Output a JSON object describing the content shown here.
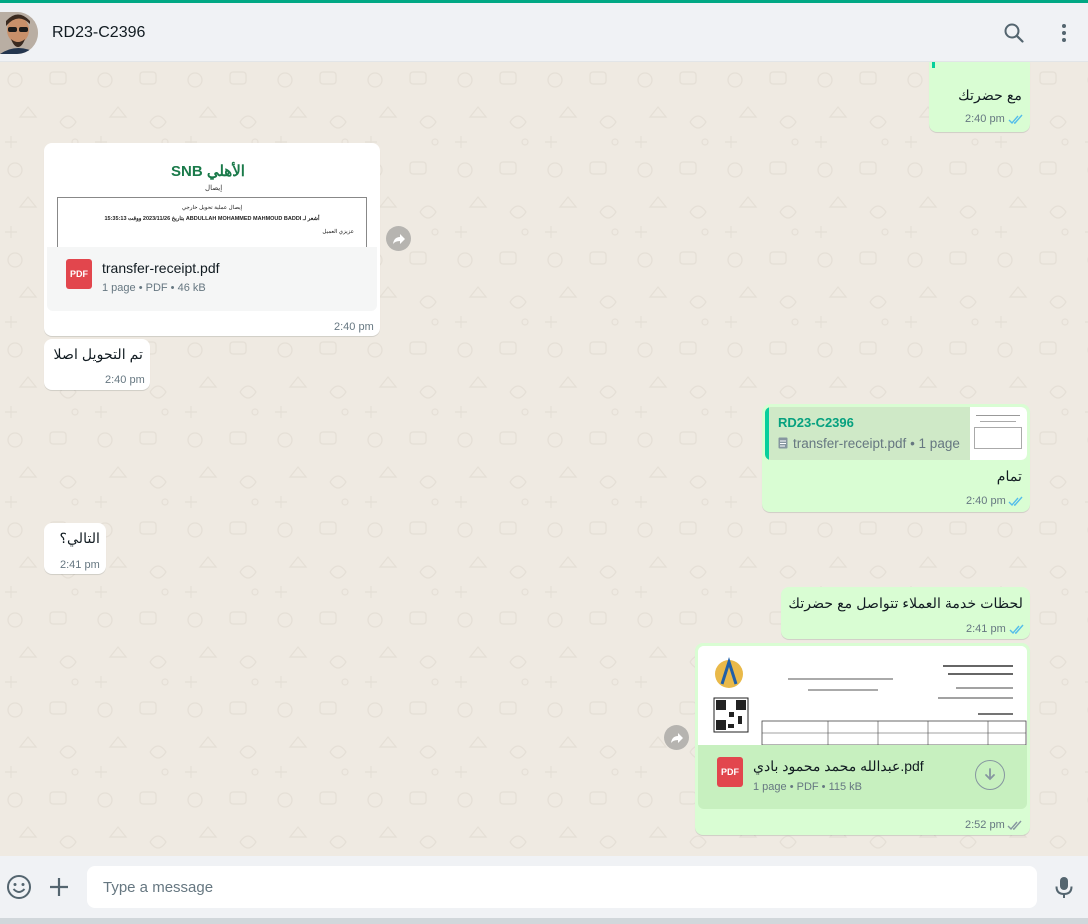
{
  "contact": {
    "name": "RD23-C2396"
  },
  "messages": {
    "m1": {
      "text": "مع حضرتك",
      "time": "2:40 pm"
    },
    "m2": {
      "preview": {
        "bank_logo": "الأهلي SNB",
        "receipt_title": "إيصال",
        "line1": "إيصال عملية تحويل خارجي",
        "line2": "أشعر لـ ABDULLAH MOHAMMED MAHMOUD BADDI بتاريخ 2023/11/26 ووقت 15:35:13",
        "line3": "عزيزي العميل"
      },
      "file_name": "transfer-receipt.pdf",
      "pages": "1 page",
      "type": "PDF",
      "size": "46 kB",
      "time": "2:40 pm"
    },
    "m3": {
      "text": "تم التحويل اصلا",
      "time": "2:40 pm"
    },
    "m4": {
      "quote_author": "RD23-C2396",
      "quote_file": "transfer-receipt.pdf",
      "quote_pages": "1 page",
      "text": "تمام",
      "time": "2:40 pm"
    },
    "m5": {
      "text": "التالي؟",
      "time": "2:41 pm"
    },
    "m6": {
      "text": "لحظات خدمة العملاء تتواصل مع حضرتك",
      "time": "2:41 pm"
    },
    "m7": {
      "file_name": "عبدالله محمد محمود بادي.pdf",
      "pages": "1 page",
      "type": "PDF",
      "size": "115 kB",
      "time": "2:52 pm"
    }
  },
  "composer": {
    "placeholder": "Type a message"
  },
  "colors": {
    "accent": "#00a884",
    "outgoing": "#d9fdd3",
    "incoming": "#ffffff",
    "read_tick": "#53bdeb",
    "pdf_red": "#e2464d"
  },
  "icons": {
    "search": "search-icon",
    "menu": "menu-icon",
    "emoji": "emoji-icon",
    "attach": "plus-icon",
    "mic": "mic-icon",
    "forward": "forward-icon",
    "download": "download-icon"
  }
}
